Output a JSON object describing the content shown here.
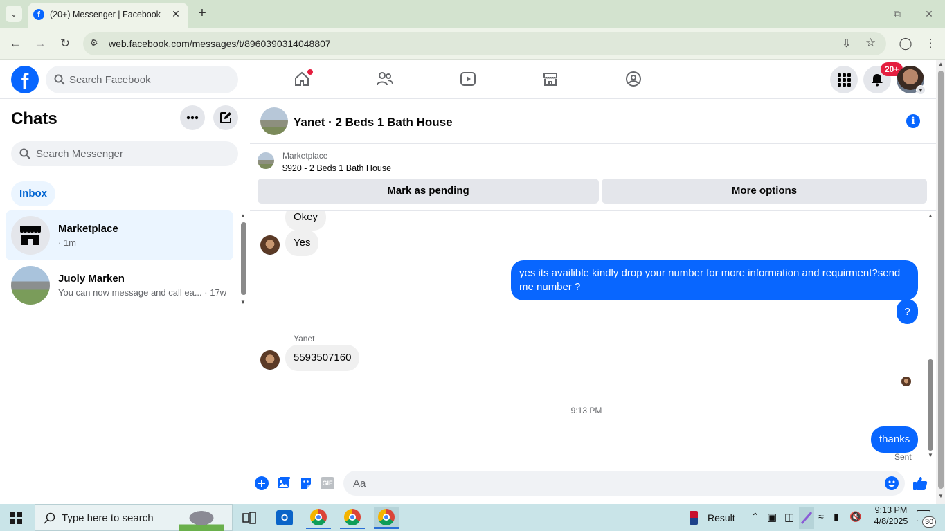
{
  "browser": {
    "tab_title": "(20+) Messenger | Facebook",
    "url": "web.facebook.com/messages/t/8960390314048807"
  },
  "fb_header": {
    "search_placeholder": "Search Facebook",
    "notification_badge": "20+"
  },
  "chats_panel": {
    "title": "Chats",
    "search_placeholder": "Search Messenger",
    "filter": "Inbox",
    "items": [
      {
        "name": "Marketplace",
        "subtitle": "· 1m"
      },
      {
        "name": "Juoly Marken",
        "subtitle": "You can now message and call ea... · 17w"
      }
    ]
  },
  "conversation": {
    "title": "Yanet · 2 Beds 1 Bath House",
    "marketplace_label": "Marketplace",
    "listing": "$920 - 2 Beds 1 Bath House",
    "mark_pending": "Mark as pending",
    "more_options": "More options",
    "messages": {
      "m1": "Okey",
      "m2": "Yes",
      "m3": "yes its availible kindly drop your number for more information and requirment?send me number ?",
      "m4": "?",
      "sender": "Yanet",
      "m5": "5593507160",
      "timestamp": "9:13 PM",
      "m6": "thanks",
      "status": "Sent"
    },
    "composer_placeholder": "Aa"
  },
  "taskbar": {
    "search_placeholder": "Type here to search",
    "result_label": "Result",
    "time": "9:13 PM",
    "date": "4/8/2025",
    "notification_count": "30"
  },
  "colors": {
    "fb_blue": "#0866ff",
    "selected_chat": "#ebf5ff",
    "badge_red": "#e41e3f"
  }
}
